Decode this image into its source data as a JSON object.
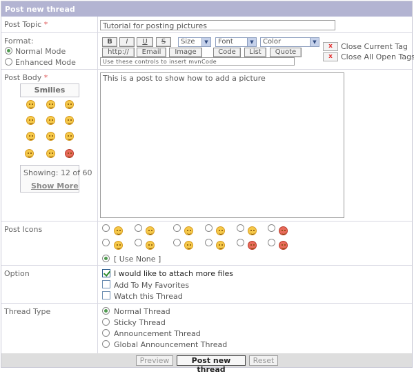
{
  "header": {
    "title": "Post new thread"
  },
  "topic": {
    "label": "Post Topic",
    "required_mark": "*",
    "value": "Tutorial for posting pictures"
  },
  "format": {
    "label": "Format:",
    "modes": [
      {
        "label": "Normal Mode",
        "selected": true
      },
      {
        "label": "Enhanced Mode",
        "selected": false
      }
    ],
    "toolbar": {
      "bold": "B",
      "italic": "I",
      "underline": "U",
      "strike": "S",
      "size": "Size",
      "font": "Font",
      "color": "Color",
      "http": "http://",
      "email": "Email",
      "image": "Image",
      "code": "Code",
      "list": "List",
      "quote": "Quote",
      "hint": "Use these controls to insert mvnCode",
      "close_current": "Close Current Tag",
      "close_all": "Close All Open Tags",
      "x": "x"
    }
  },
  "body": {
    "label": "Post Body",
    "required_mark": "*",
    "text": "This is a post to show how to add a picture",
    "smilies_title": "Smilies",
    "showing": "Showing: 12 of 60",
    "show_more": "Show More"
  },
  "post_icons": {
    "label": "Post Icons",
    "use_none": "[ Use None ]"
  },
  "option": {
    "label": "Option",
    "items": [
      {
        "label": "I would like to attach more files",
        "checked": true
      },
      {
        "label": "Add To My Favorites",
        "checked": false
      },
      {
        "label": "Watch this Thread",
        "checked": false
      }
    ]
  },
  "thread_type": {
    "label": "Thread Type",
    "items": [
      {
        "label": "Normal Thread",
        "selected": true
      },
      {
        "label": "Sticky Thread",
        "selected": false
      },
      {
        "label": "Announcement Thread",
        "selected": false
      },
      {
        "label": "Global Announcement Thread",
        "selected": false
      }
    ]
  },
  "footer": {
    "preview": "Preview",
    "submit": "Post new thread",
    "reset": "Reset"
  }
}
